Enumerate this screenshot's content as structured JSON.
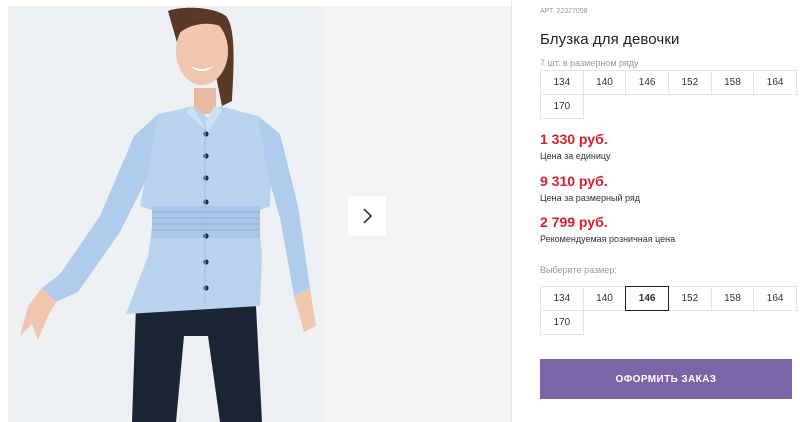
{
  "product": {
    "sku_label": "АРТ.",
    "sku_value": "22327058",
    "title": "Блузка для девочки",
    "size_range_note": "7 шт. в размерном ряду",
    "range_sizes": [
      "134",
      "140",
      "146",
      "152",
      "158",
      "164",
      "170"
    ],
    "prices": [
      {
        "amount": "1 330 руб.",
        "label": "Цена за единицу"
      },
      {
        "amount": "9 310 руб.",
        "label": "Цена за размерный ряд"
      },
      {
        "amount": "2 799 руб.",
        "label": "Рекомендуемая розничная цена"
      }
    ],
    "choose_size_label": "Выберите размер:",
    "select_sizes": [
      "134",
      "140",
      "146",
      "152",
      "158",
      "164",
      "170"
    ],
    "selected_size": "146",
    "order_button": "ОФОРМИТЬ ЗАКАЗ"
  },
  "gallery": {
    "next_icon": "chevron-right-icon"
  },
  "colors": {
    "price": "#d51f2a",
    "order_button_bg": "#7b65a6",
    "photo_bg": "#eef0f2",
    "blouse": "#b9d3ef",
    "trousers": "#1b2435"
  }
}
